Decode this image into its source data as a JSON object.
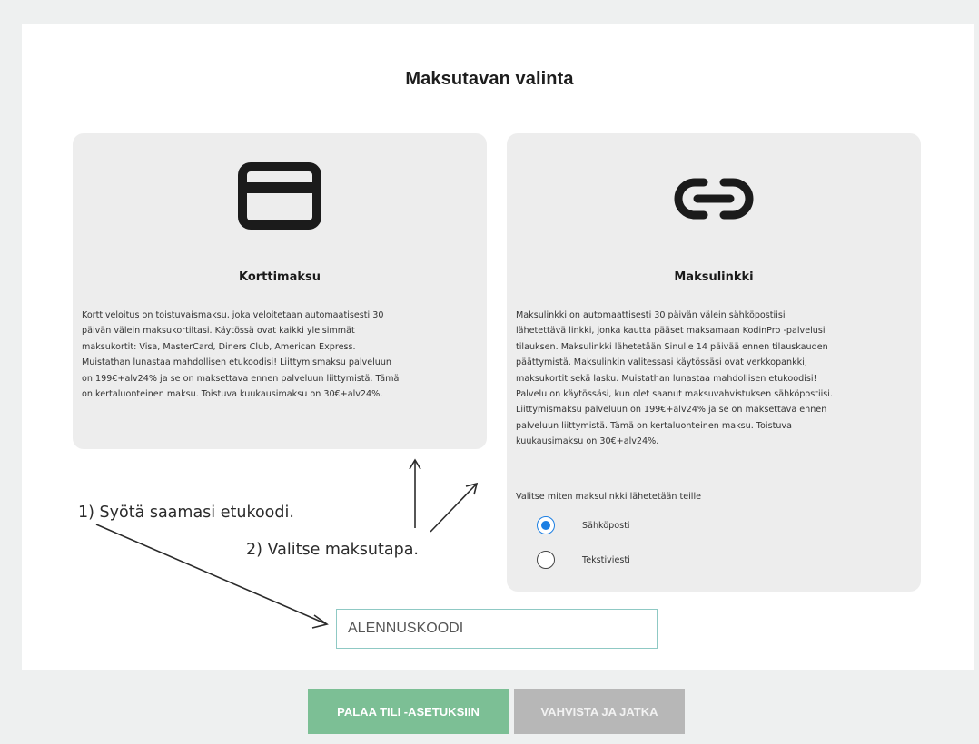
{
  "page": {
    "title": "Maksutavan valinta"
  },
  "cards": {
    "card_payment": {
      "icon": "credit-card-icon",
      "title": "Korttimaksu",
      "lines": [
        "Korttiveloitus on toistuvaismaksu, joka veloitetaan automaatisesti 30",
        "päivän välein maksukortiltasi. Käytössä ovat kaikki yleisimmät",
        "maksukortit: Visa, MasterCard, Diners Club, American Express.",
        "Muistathan lunastaa mahdollisen etukoodisi! Liittymismaksu palveluun",
        "on 199€+alv24% ja se on maksettava ennen palveluun liittymistä. Tämä",
        "on kertaluonteinen maksu. Toistuva kuukausimaksu on 30€+alv24%."
      ]
    },
    "payment_link": {
      "icon": "link-icon",
      "title": "Maksulinkki",
      "lines": [
        "Maksulinkki on automaattisesti 30 päivän välein sähköpostiisi",
        "lähetettävä linkki, jonka kautta pääset maksamaan KodinPro -palvelusi",
        "tilauksen. Maksulinkki lähetetään Sinulle 14 päivää ennen tilauskauden",
        "päättymistä. Maksulinkin valitessasi käytössäsi ovat verkkopankki,",
        "maksukortit sekä lasku. Muistathan lunastaa mahdollisen etukoodisi!",
        "Palvelu on käytössäsi, kun olet saanut maksuvahvistuksen sähköpostiisi.",
        "Liittymismaksu palveluun on 199€+alv24% ja se on maksettava ennen",
        "palveluun liittymistä. Tämä on kertaluonteinen maksu. Toistuva",
        "kuukausimaksu on 30€+alv24%."
      ],
      "delivery_label": "Valitse miten maksulinkki lähetetään teille",
      "options": [
        {
          "label": "Sähköposti",
          "checked": true
        },
        {
          "label": "Tekstiviesti",
          "checked": false
        }
      ]
    }
  },
  "discount": {
    "placeholder": "ALENNUSKOODI",
    "value": ""
  },
  "annotations": {
    "step1": "1) Syötä saamasi etukoodi.",
    "step2": "2) Valitse maksutapa."
  },
  "buttons": {
    "back_label": "PALAA TILI -ASETUKSIIN",
    "confirm_label": "VAHVISTA JA JATKA"
  },
  "colors": {
    "radio_selected": "#1c7fe3",
    "back_button": "#7cbf95",
    "confirm_button_disabled": "#b7b7b7",
    "input_border": "#8fc9c4"
  }
}
